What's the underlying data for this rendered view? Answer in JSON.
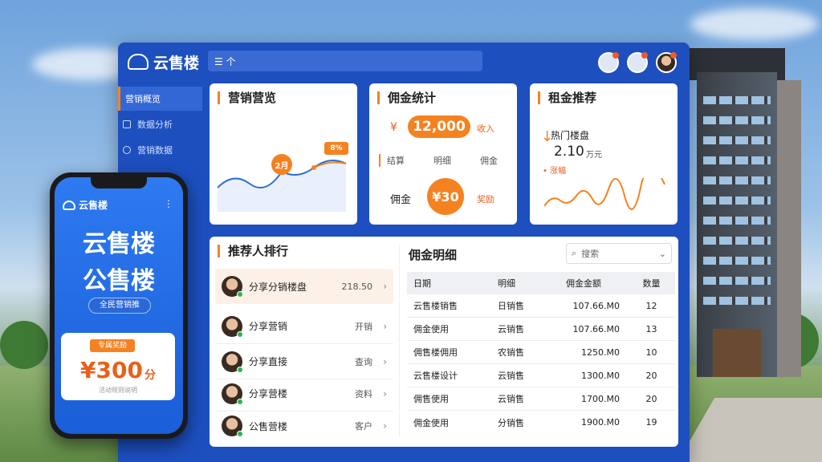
{
  "app": {
    "name": "云售楼",
    "menu_label": "☰ 个"
  },
  "sidebar": {
    "items": [
      {
        "label": "营销概览",
        "active": true
      },
      {
        "label": "数据分析",
        "active": false
      },
      {
        "label": "营销数据",
        "active": false
      }
    ]
  },
  "marketing": {
    "title": "营销营览",
    "pill_left": "2月",
    "pill_right": "8%"
  },
  "commission": {
    "title": "佣金统计",
    "currency": "¥",
    "amount": "12,000",
    "tag": "收入",
    "links": [
      "结算",
      "明细",
      "佣金"
    ],
    "label": "佣金",
    "badge_value": "¥30",
    "badge_note": "奖励"
  },
  "rent": {
    "title": "租金推荐",
    "sub": "热门楼盘",
    "value": "2.10",
    "unit": "万元",
    "note": "• 涨幅"
  },
  "referrers": {
    "title": "推荐人排行",
    "rows": [
      {
        "name": "分享分销楼盘",
        "value": "218.50"
      },
      {
        "name": "分享营销",
        "value": "开销"
      },
      {
        "name": "分享直接",
        "value": "查询"
      },
      {
        "name": "分享营楼",
        "value": "资料"
      },
      {
        "name": "公售营楼",
        "value": "客户"
      }
    ]
  },
  "details": {
    "title": "佣金明细",
    "search_placeholder": "搜索",
    "headers": [
      "日期",
      "明细",
      "佣金金额",
      "数量"
    ],
    "rows": [
      [
        "云售楼销售",
        "日销售",
        "107.66.M0",
        "12"
      ],
      [
        "佣金使用",
        "云销售",
        "107.66.M0",
        "13"
      ],
      [
        "佣售楼佣用",
        "农销售",
        "1250.M0",
        "10"
      ],
      [
        "云售楼设计",
        "云销售",
        "1300.M0",
        "20"
      ],
      [
        "佣售使用",
        "云销售",
        "1700.M0",
        "20"
      ],
      [
        "佣金使用",
        "分销售",
        "1900.M0",
        "19"
      ]
    ]
  },
  "phone": {
    "brand": "云售楼",
    "line1": "云售楼",
    "line2": "公售楼",
    "chip": "全民营销推",
    "coupon_tag": "专属奖励",
    "amount": "¥300",
    "unit": "分",
    "coupon_note": "活动规则说明"
  },
  "colors": {
    "brand_blue": "#1d4fbf",
    "accent_orange": "#f58220",
    "trend_line": "#2a6fd6"
  }
}
